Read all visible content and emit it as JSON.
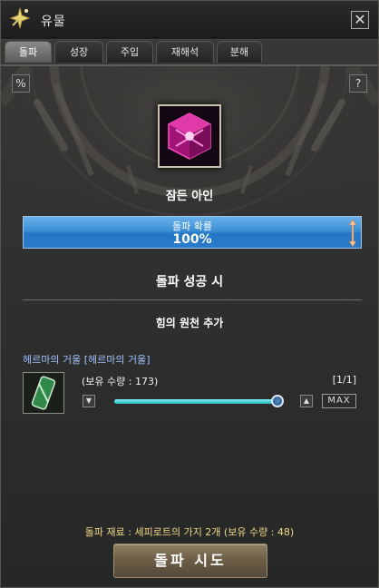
{
  "window": {
    "title": "유물",
    "title_icon": "star-sparkle-icon",
    "close_label": "✕"
  },
  "tabs": [
    {
      "label": "돌파",
      "active": true
    },
    {
      "label": "성장",
      "active": false
    },
    {
      "label": "주입",
      "active": false
    },
    {
      "label": "재해석",
      "active": false
    },
    {
      "label": "분해",
      "active": false
    }
  ],
  "toolbar": {
    "percent_label": "%",
    "help_label": "?"
  },
  "relic": {
    "name": "잠든 아인",
    "icon": "magenta-cube-icon"
  },
  "breakthrough_rate": {
    "label": "돌파 확률",
    "value": "100%"
  },
  "success": {
    "title": "돌파 성공 시",
    "effect": "힘의 원천 추가"
  },
  "material": {
    "name": "헤르마의 거울 [헤르마의 거울]",
    "owned": "(보유 수량 : 173)",
    "ratio": "[1/1]",
    "slider_level": 1.0,
    "max_label": "MAX",
    "icon": "mirror-icon"
  },
  "footer": {
    "material_info": "돌파 재료 : 세피로트의 가지 2개 (보유 수량 : 48)",
    "attempt_label": "돌파 시도"
  },
  "colors": {
    "rate_bar": "#2f86d0",
    "material_name": "#9fc3ff",
    "footer_text": "#f2d88a",
    "slider_fill": "#3fd0d6"
  }
}
